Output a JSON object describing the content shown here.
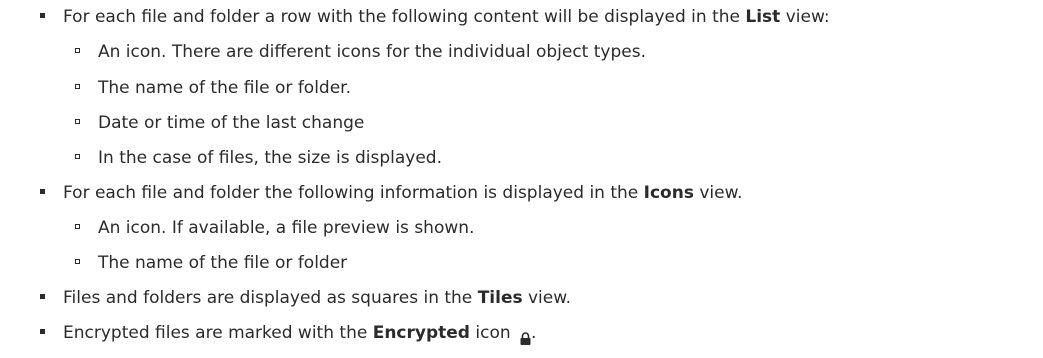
{
  "items": [
    {
      "pre": "For each file and folder a row with the following content will be displayed in the ",
      "bold": "List",
      "post": " view:",
      "sub": [
        "An icon. There are different icons for the individual object types.",
        "The name of the file or folder.",
        "Date or time of the last change",
        "In the case of files, the size is displayed."
      ]
    },
    {
      "pre": "For each file and folder the following information is displayed in the ",
      "bold": "Icons",
      "post": " view.",
      "sub": [
        "An icon. If available, a file preview is shown.",
        "The name of the file or folder"
      ]
    },
    {
      "pre": "Files and folders are displayed as squares in the ",
      "bold": "Tiles",
      "post": " view."
    },
    {
      "pre": "Encrypted files are marked with the ",
      "bold": "Encrypted",
      "post": " icon",
      "trail": ".",
      "icon": "lock-icon"
    }
  ]
}
